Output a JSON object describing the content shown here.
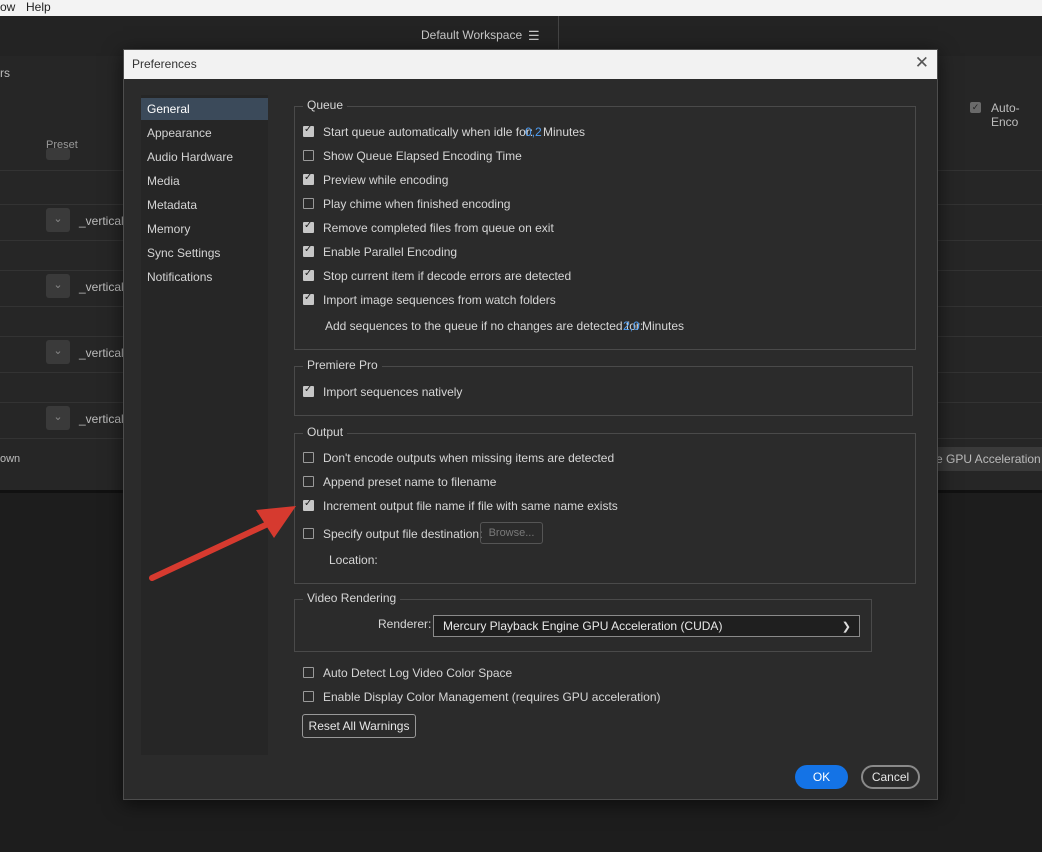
{
  "menubar": {
    "items": [
      "ow",
      "Help"
    ]
  },
  "topbar": {
    "workspace": "Default Workspace",
    "workspace_menu_icon": "hamburger-icon"
  },
  "background": {
    "panel_title_fragment": "rs",
    "preset_header": "Preset",
    "preset_rows": [
      "_vertical",
      "_vertical",
      "_vertical",
      "_vertical"
    ],
    "auto_encode_label": "Auto-Enco",
    "bottom_left_fragment": "own",
    "gpu_button_fragment": "e GPU Acceleration (C"
  },
  "dialog": {
    "title": "Preferences",
    "close_icon": "close-icon",
    "sidebar": [
      "General",
      "Appearance",
      "Audio Hardware",
      "Media",
      "Metadata",
      "Memory",
      "Sync Settings",
      "Notifications"
    ],
    "active_sidebar_index": 0,
    "queue": {
      "legend": "Queue",
      "items": [
        {
          "label": "Start queue automatically when idle for:",
          "checked": true,
          "value": "0,2",
          "unit": "Minutes"
        },
        {
          "label": "Show Queue Elapsed Encoding Time",
          "checked": false
        },
        {
          "label": "Preview while encoding",
          "checked": true
        },
        {
          "label": "Play chime when finished encoding",
          "checked": false
        },
        {
          "label": "Remove completed files from queue on exit",
          "checked": true
        },
        {
          "label": "Enable Parallel Encoding",
          "checked": true
        },
        {
          "label": "Stop current item if decode errors are detected",
          "checked": true
        },
        {
          "label": "Import image sequences from watch folders",
          "checked": true
        }
      ],
      "add_sequences_label": "Add sequences to the queue if no changes are detected for:",
      "add_sequences_value": "2,0",
      "add_sequences_unit": "Minutes"
    },
    "premiere": {
      "legend": "Premiere Pro",
      "items": [
        {
          "label": "Import sequences natively",
          "checked": true
        }
      ]
    },
    "output": {
      "legend": "Output",
      "items": [
        {
          "label": "Don't encode outputs when missing items are detected",
          "checked": false
        },
        {
          "label": "Append preset name to filename",
          "checked": false
        },
        {
          "label": "Increment output file name if file with same name exists",
          "checked": true
        },
        {
          "label": "Specify output file destination:",
          "checked": false
        }
      ],
      "browse_label": "Browse...",
      "location_label": "Location:"
    },
    "video_rendering": {
      "legend": "Video Rendering",
      "renderer_label": "Renderer:",
      "renderer_value": "Mercury Playback Engine GPU Acceleration (CUDA)"
    },
    "extra": [
      {
        "label": "Auto Detect Log Video Color Space",
        "checked": false
      },
      {
        "label": "Enable Display Color Management (requires GPU acceleration)",
        "checked": false
      }
    ],
    "reset_warnings": "Reset All Warnings",
    "ok": "OK",
    "cancel": "Cancel"
  },
  "annotation": {
    "color": "#d63a2f",
    "icon": "red-arrow-icon"
  }
}
